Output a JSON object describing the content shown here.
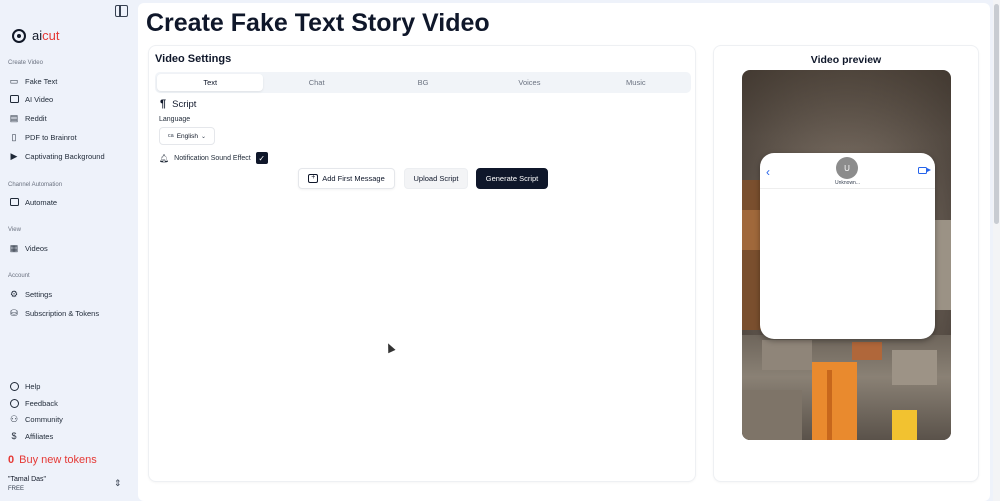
{
  "sidebar": {
    "brand": {
      "prefix": "ai",
      "accent": "cut"
    },
    "sections": [
      {
        "label": "Create Video"
      },
      {
        "label": "Channel Automation"
      },
      {
        "label": "View"
      },
      {
        "label": "Account"
      }
    ],
    "items": [
      {
        "label": "Fake Text",
        "icon": "chat-square-icon"
      },
      {
        "label": "AI Video",
        "icon": "image-plus-icon"
      },
      {
        "label": "Reddit",
        "icon": "document-icon"
      },
      {
        "label": "PDF to Brainrot",
        "icon": "file-icon"
      },
      {
        "label": "Captivating Background",
        "icon": "video-camera-icon"
      },
      {
        "label": "Automate",
        "icon": "robot-icon"
      },
      {
        "label": "Videos",
        "icon": "film-icon"
      },
      {
        "label": "Settings",
        "icon": "gear-icon"
      },
      {
        "label": "Subscription & Tokens",
        "icon": "tokens-icon"
      },
      {
        "label": "Help",
        "icon": "help-circle-icon"
      },
      {
        "label": "Feedback",
        "icon": "plus-circle-icon"
      },
      {
        "label": "Community",
        "icon": "users-icon"
      },
      {
        "label": "Affiliates",
        "icon": "dollar-circle-icon"
      }
    ],
    "tokens": {
      "count": "0",
      "label": "Buy new tokens"
    },
    "user": {
      "name": "\"Tamal Das\"",
      "plan": "FREE"
    }
  },
  "main": {
    "title": "Create Fake Text Story Video",
    "settings": {
      "title": "Video Settings",
      "tabs": [
        "Text",
        "Chat",
        "BG",
        "Voices",
        "Music"
      ],
      "active_tab": "Text",
      "script_label": "Script",
      "language_label": "Language",
      "language_flag": "ca",
      "language_value": "English",
      "notification_label": "Notification Sound Effect",
      "notification_checked": true,
      "buttons": {
        "add_first_message": "Add First Message",
        "upload_script": "Upload Script",
        "generate_script": "Generate Script"
      }
    },
    "preview": {
      "title": "Video preview",
      "contact_initial": "U",
      "contact_name": "Unknown..."
    }
  },
  "colors": {
    "accent_red": "#e53935",
    "primary_dark": "#0f172a",
    "ios_blue": "#2563eb",
    "sidebar_bg": "#eef2fa"
  }
}
